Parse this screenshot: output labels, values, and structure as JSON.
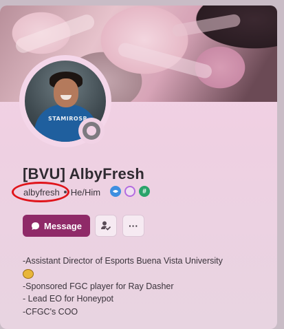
{
  "profile": {
    "display_name": "[BVU] AlbyFresh",
    "username": "albyfresh",
    "pronouns": "He/Him",
    "status": "offline",
    "avatar_shirt_text": "STAMIROSR"
  },
  "badges": [
    {
      "name": "nitro-badge-icon",
      "color": "#3e8fe0"
    },
    {
      "name": "boost-badge-icon",
      "color": "#b46be0"
    },
    {
      "name": "hashtag-badge-icon",
      "color": "#2aa36a",
      "glyph": "#"
    }
  ],
  "actions": {
    "message_label": "Message",
    "more_label": "···"
  },
  "bio": {
    "line1": "-Assistant Director of Esports Buena Vista University",
    "line2": "-Sponsored FGC player for Ray Dasher",
    "line3": "- Lead EO for Honeypot",
    "line4": "-CFGC's COO"
  },
  "colors": {
    "accent": "#8f2a68",
    "highlight_ring": "#e0141b",
    "card_bg": "#f6d3e8"
  }
}
